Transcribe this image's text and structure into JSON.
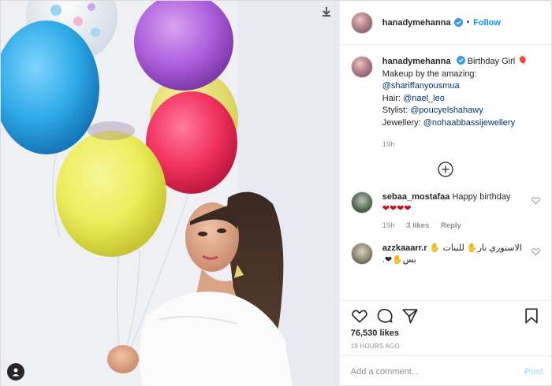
{
  "header": {
    "username": "hanadymehanna",
    "separator": "•",
    "follow_label": "Follow"
  },
  "caption": {
    "username": "hanadymehanna",
    "text_lead": "Birthday Girl",
    "emoji": "🎈",
    "line2": "Makeup by the amazing:",
    "mention1": "@shariffanyousmua",
    "hair_label": "Hair:",
    "mention2": "@nael_leo",
    "stylist_label": "Stylist:",
    "mention3": "@poucyelshahawy",
    "jewellery_label": "Jewellery:",
    "mention4": "@nohaabbassijewellery",
    "time": "19h"
  },
  "comments": [
    {
      "username": "sebaa_mostafaa",
      "text": "Happy birthday",
      "emoji": "❤❤❤❤",
      "time": "19h",
      "likes": "3 likes",
      "reply": "Reply"
    },
    {
      "username": "azzkaaarr.r",
      "text": "الاستوري نار✋ للبنات ✋ بس✋❤.",
      "time": "",
      "likes": "",
      "reply": ""
    }
  ],
  "actions": {
    "likes": "76,530 likes",
    "timestamp": "19 HOURS AGO"
  },
  "add_comment": {
    "placeholder": "Add a comment...",
    "post_label": "Post"
  },
  "icons": {
    "save_corner": "save-icon",
    "tag_badge": "user-tag-icon",
    "verified": "verified-badge-icon",
    "load_more": "plus-circle-icon",
    "like": "heart-icon",
    "comment": "comment-icon",
    "share": "paper-plane-icon",
    "save": "bookmark-icon"
  },
  "colors": {
    "link": "#00376b",
    "follow": "#0095f6",
    "post_disabled": "#b2dffc",
    "verified": "#3897f0"
  }
}
